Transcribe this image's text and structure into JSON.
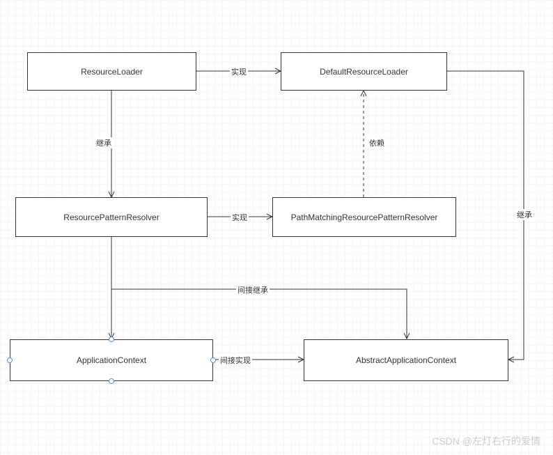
{
  "nodes": {
    "resourceLoader": "ResourceLoader",
    "defaultResourceLoader": "DefaultResourceLoader",
    "resourcePatternResolver": "ResourcePatternResolver",
    "pathMatchingResolver": "PathMatchingResourcePatternResolver",
    "applicationContext": "ApplicationContext",
    "abstractApplicationContext": "AbstractApplicationContext"
  },
  "edges": {
    "implement1": "实现",
    "inherit1": "继承",
    "depend": "依赖",
    "inherit2": "继承",
    "implement2": "实现",
    "indirectInherit": "间接继承",
    "indirectImplement": "间接实现"
  },
  "watermark": "CSDN @左灯右行的爱情"
}
